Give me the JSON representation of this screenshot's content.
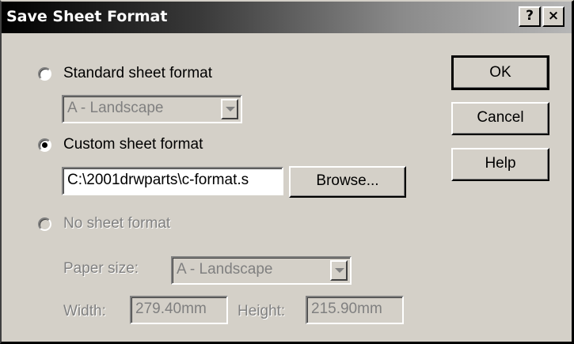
{
  "window": {
    "title": "Save Sheet Format",
    "help_glyph": "?",
    "close_glyph": "×"
  },
  "options": {
    "standard_label": "Standard sheet format",
    "standard_value": "A - Landscape",
    "custom_label": "Custom sheet format",
    "custom_path": "C:\\2001drwparts\\c-format.s",
    "none_label": "No sheet format",
    "selected": "custom"
  },
  "paper": {
    "size_label": "Paper size:",
    "size_value": "A - Landscape",
    "width_label": "Width:",
    "width_value": "279.40mm",
    "height_label": "Height:",
    "height_value": "215.90mm"
  },
  "buttons": {
    "ok": "OK",
    "cancel": "Cancel",
    "help": "Help",
    "browse": "Browse..."
  }
}
